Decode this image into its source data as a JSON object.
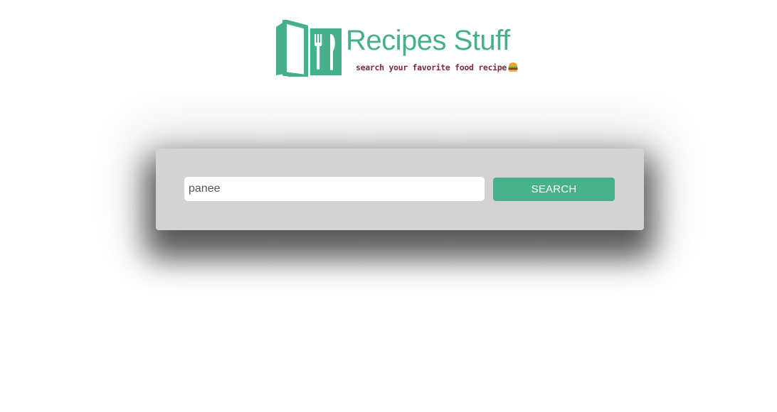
{
  "brand": {
    "title": "Recipes Stuff",
    "tagline": "search your favorite food recipe",
    "icon_name": "recipe-book-icon",
    "tagline_icon_name": "burger-icon",
    "accent_color": "#46b08b",
    "tagline_color": "#7d2a3d"
  },
  "search": {
    "input_value": "panee",
    "button_label": "SEARCH",
    "button_color": "#47b28a",
    "panel_color": "#d3d3d3"
  }
}
